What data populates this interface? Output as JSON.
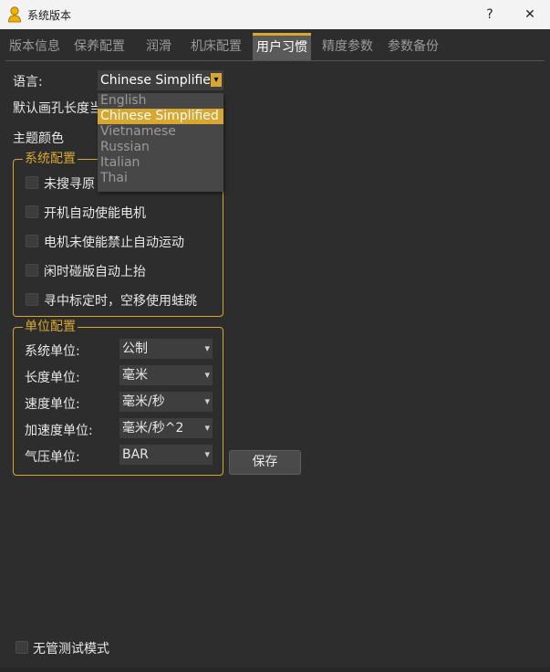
{
  "window": {
    "title": "系统版本",
    "help_label": "?",
    "close_label": "✕",
    "icon": "user-lock-icon"
  },
  "tabs": [
    {
      "label": "版本信息",
      "active": false
    },
    {
      "label": "保养配置",
      "active": false
    },
    {
      "label": "润滑",
      "active": false
    },
    {
      "label": "机床配置",
      "active": false
    },
    {
      "label": "用户习惯",
      "active": true
    },
    {
      "label": "精度参数",
      "active": false
    },
    {
      "label": "参数备份",
      "active": false
    }
  ],
  "settings": {
    "language_label": "语言:",
    "language_value": "Chinese Simplified",
    "default_hole_label": "默认画孔长度当",
    "theme_color_label": "主题颜色"
  },
  "language_dropdown": {
    "options": [
      "English",
      "Chinese Simplified",
      "Vietnamese",
      "Russian",
      "Italian",
      "Thai"
    ],
    "selected": "Chinese Simplified"
  },
  "system_config": {
    "title": "系统配置",
    "options": [
      {
        "label": "未搜寻原",
        "checked": false
      },
      {
        "label": "开机自动使能电机",
        "checked": false
      },
      {
        "label": "电机未使能禁止自动运动",
        "checked": false
      },
      {
        "label": "闲时碰版自动上抬",
        "checked": false
      },
      {
        "label": "寻中标定时，空移使用蛙跳",
        "checked": false
      }
    ]
  },
  "unit_config": {
    "title": "单位配置",
    "rows": [
      {
        "label": "系统单位:",
        "value": "公制"
      },
      {
        "label": "长度单位:",
        "value": "毫米"
      },
      {
        "label": "速度单位:",
        "value": "毫米/秒"
      },
      {
        "label": "加速度单位:",
        "value": "毫米/秒^2"
      },
      {
        "label": "气压单位:",
        "value": "BAR"
      }
    ]
  },
  "save_button": "保存",
  "unattended_mode": {
    "label": "无管测试模式",
    "checked": false
  },
  "colors": {
    "accent": "#d9a730",
    "background": "#2d2d2d"
  }
}
